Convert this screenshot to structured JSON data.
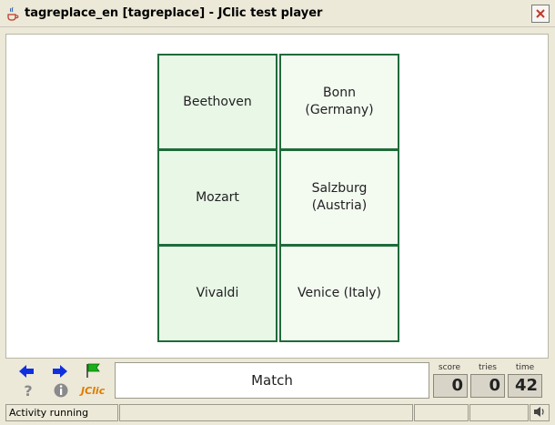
{
  "window": {
    "title": "tagreplace_en [tagreplace] - JClic test player"
  },
  "board": {
    "left_cells": [
      "Beethoven",
      "Mozart",
      "Vivaldi"
    ],
    "right_cells": [
      "Bonn\n(Germany)",
      "Salzburg\n(Austria)",
      "Venice (Italy)"
    ]
  },
  "message": "Match",
  "counters": {
    "score_label": "score",
    "score": "0",
    "tries_label": "tries",
    "tries": "0",
    "time_label": "time",
    "time": "42"
  },
  "toolbar": {
    "jclic_label": "JClic"
  },
  "status": {
    "text": "Activity running"
  },
  "icons": {
    "prev": "arrow-left-icon",
    "next": "arrow-right-icon",
    "reset": "green-flag-icon",
    "help": "question-icon",
    "info": "info-icon",
    "sound": "speaker-icon"
  },
  "colors": {
    "cell_border": "#1f6b3a",
    "cell_left_bg": "#e8f7e6",
    "cell_right_bg": "#f3fbf1",
    "nav_blue": "#1030e0",
    "jclic_orange": "#e07a00"
  }
}
